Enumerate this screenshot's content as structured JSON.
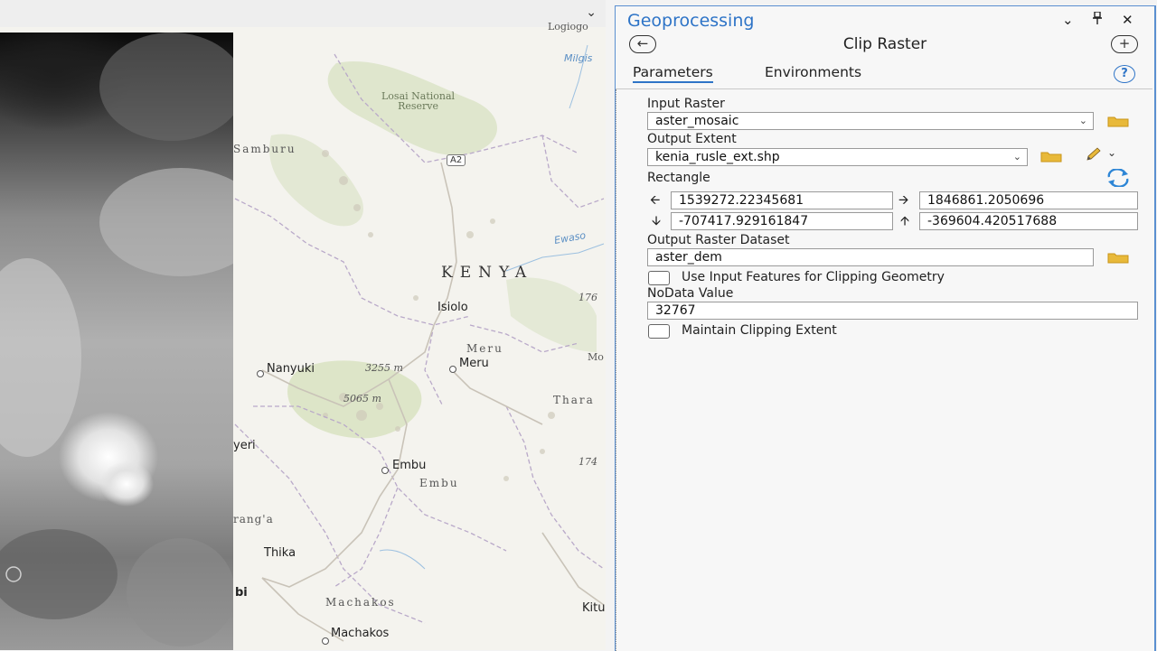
{
  "map": {
    "labels": {
      "logologo": "Logiogo",
      "milgis": "Milgis",
      "losai": "Losai National\nReserve",
      "samburu": "Samburu",
      "a2": "A2",
      "ewaso": "Ewaso",
      "kenya": "KENYA",
      "isiolo": "Isiolo",
      "n176": "176",
      "meru_region": "Meru",
      "meru_town": "Meru",
      "mo": "Mo",
      "nanyuki": "Nanyuki",
      "elev1": "3255 m",
      "elev2": "5065 m",
      "thara": "Thara",
      "nyeri": "yeri",
      "embu_town": "Embu",
      "embu_region": "Embu",
      "n174": "174",
      "muranga": "rang'a",
      "thika": "Thika",
      "nairobi": "bi",
      "machakos_region": "Machakos",
      "machakos_town": "Machakos",
      "kitui": "Kitu"
    },
    "colors": {
      "land": "#f4f3ee",
      "reserve": "#dfe6cd",
      "water": "#5b8fc4",
      "roads": "#b9a9c9"
    }
  },
  "panel": {
    "title": "Geoprocessing",
    "tool_title": "Clip Raster",
    "tabs": {
      "parameters": "Parameters",
      "environments": "Environments"
    },
    "accent": "#2e74c7",
    "params": {
      "input_raster_label": "Input Raster",
      "input_raster_value": "aster_mosaic",
      "output_extent_label": "Output Extent",
      "output_extent_value": "kenia_rusle_ext.shp",
      "rectangle_label": "Rectangle",
      "rect_left": "1539272.22345681",
      "rect_right": "1846861.2050696",
      "rect_bottom": "-707417.929161847",
      "rect_top": "-369604.420517688",
      "output_dataset_label": "Output Raster Dataset",
      "output_dataset_value": "aster_dem",
      "use_input_features_label": "Use Input Features for Clipping Geometry",
      "use_input_features_checked": false,
      "nodata_label": "NoData Value",
      "nodata_value": "32767",
      "maintain_extent_label": "Maintain Clipping Extent",
      "maintain_extent_checked": false
    }
  }
}
